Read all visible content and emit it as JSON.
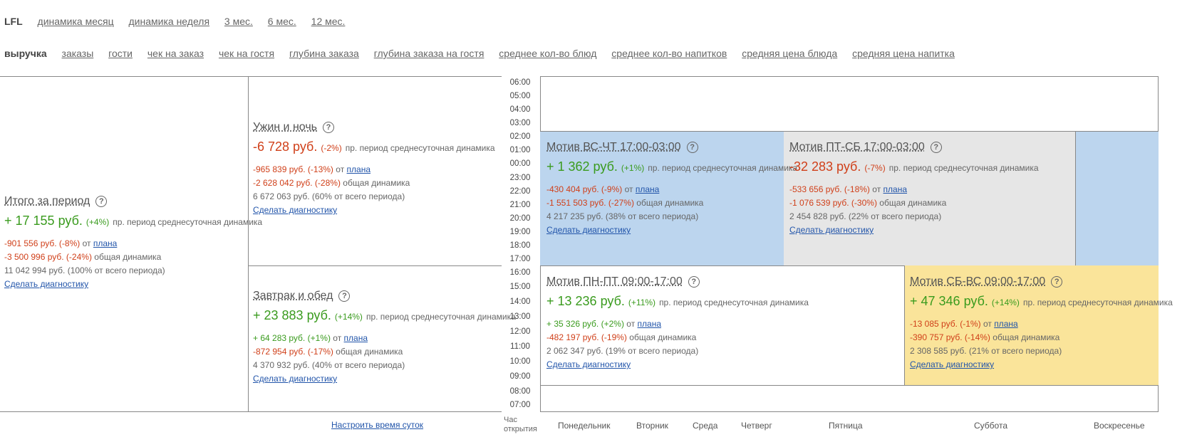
{
  "nav_periods": [
    "LFL",
    "динамика месяц",
    "динамика неделя",
    "3 мес.",
    "6 мес.",
    "12 мес."
  ],
  "nav_metrics": [
    "выручка",
    "заказы",
    "гости",
    "чек на заказ",
    "чек на гостя",
    "глубина заказа",
    "глубина заказа на гостя",
    "среднее кол-во блюд",
    "среднее кол-во напитков",
    "средняя цена блюда",
    "средняя цена напитка"
  ],
  "hours": [
    "06:00",
    "05:00",
    "04:00",
    "03:00",
    "02:00",
    "01:00",
    "00:00",
    "23:00",
    "22:00",
    "21:00",
    "20:00",
    "19:00",
    "18:00",
    "17:00",
    "16:00",
    "15:00",
    "14:00",
    "13:00",
    "12:00",
    "11:00",
    "10:00",
    "09:00",
    "08:00",
    "07:00"
  ],
  "footer": {
    "configure": "Настроить время суток",
    "hour_label_1": "Час",
    "hour_label_2": "открытия",
    "days": [
      "Понедельник",
      "Вторник",
      "Среда",
      "Четверг",
      "Пятница",
      "Суббота",
      "Воскресенье"
    ]
  },
  "colors": {
    "blue": "#bcd5ee",
    "grey": "#e6e6e6",
    "yellow": "#fae49a",
    "positive": "#3a9b1e",
    "negative": "#d0401a",
    "link": "#2255aa"
  },
  "question_mark": "?",
  "blocks": {
    "total": {
      "title": "Итого за период",
      "main_value": "+ 17 155 руб.",
      "main_pct": "(+4%)",
      "main_desc": "пр. период среднесуточная динамика",
      "plan_value": "-901 556 руб. (-8%)",
      "plan_text": "от",
      "plan_link": "плана",
      "general_value": "-3 500 996 руб. (-24%)",
      "general_text": "общая динамика",
      "share": "11 042 994 руб. (100% от всего периода)",
      "diag": "Сделать диагностику"
    },
    "dinner": {
      "title": "Ужин и ночь",
      "main_value": "-6 728 руб.",
      "main_pct": "(-2%)",
      "main_desc": "пр. период среднесуточная динамика",
      "plan_value": "-965 839 руб. (-13%)",
      "plan_text": "от",
      "plan_link": "плана",
      "general_value": "-2 628 042 руб. (-28%)",
      "general_text": "общая динамика",
      "share": "6 672 063 руб. (60% от всего периода)",
      "diag": "Сделать диагностику"
    },
    "breakfast": {
      "title": "Завтрак и обед",
      "main_value": "+ 23 883 руб.",
      "main_pct": "(+14%)",
      "main_desc": "пр. период среднесуточная динамика",
      "plan_value": "+ 64 283 руб. (+1%)",
      "plan_text": "от",
      "plan_link": "плана",
      "general_value": "-872 954 руб. (-17%)",
      "general_text": "общая динамика",
      "share": "4 370 932 руб. (40% от всего периода)",
      "diag": "Сделать диагностику"
    },
    "m1": {
      "title": "Мотив ВС-ЧТ 17:00-03:00",
      "main_value": "+ 1 362 руб.",
      "main_pct": "(+1%)",
      "main_desc": "пр. период среднесуточная динамика",
      "plan_value": "-430 404 руб. (-9%)",
      "plan_text": "от",
      "plan_link": "плана",
      "general_value": "-1 551 503 руб. (-27%)",
      "general_text": "общая динамика",
      "share": "4 217 235 руб. (38% от всего периода)",
      "diag": "Сделать диагностику"
    },
    "m2": {
      "title": "Мотив ПТ-СБ 17:00-03:00",
      "main_value": "-32 283 руб.",
      "main_pct": "(-7%)",
      "main_desc": "пр. период среднесуточная динамика",
      "plan_value": "-533 656 руб. (-18%)",
      "plan_text": "от",
      "plan_link": "плана",
      "general_value": "-1 076 539 руб. (-30%)",
      "general_text": "общая динамика",
      "share": "2 454 828 руб. (22% от всего периода)",
      "diag": "Сделать диагностику"
    },
    "m3": {
      "title": "Мотив ПН-ПТ 09:00-17:00",
      "main_value": "+ 13 236 руб.",
      "main_pct": "(+11%)",
      "main_desc": "пр. период среднесуточная динамика",
      "plan_value": "+ 35 326 руб. (+2%)",
      "plan_text": "от",
      "plan_link": "плана",
      "general_value": "-482 197 руб. (-19%)",
      "general_text": "общая динамика",
      "share": "2 062 347 руб. (19% от всего периода)",
      "diag": "Сделать диагностику"
    },
    "m4": {
      "title": "Мотив СБ-ВС 09:00-17:00",
      "main_value": "+ 47 346 руб.",
      "main_pct": "(+14%)",
      "main_desc": "пр. период среднесуточная динамика",
      "plan_value": "-13 085 руб. (-1%)",
      "plan_text": "от",
      "plan_link": "плана",
      "general_value": "-390 757 руб. (-14%)",
      "general_text": "общая динамика",
      "share": "2 308 585 руб. (21% от всего периода)",
      "diag": "Сделать диагностику"
    }
  }
}
